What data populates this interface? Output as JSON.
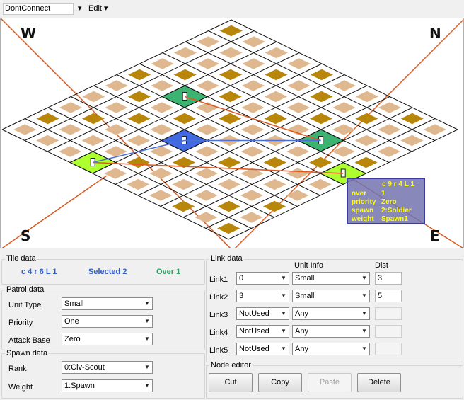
{
  "toolbar": {
    "map_name": "DontConnect",
    "menu_arrow": "▾",
    "edit_label": "Edit ▾"
  },
  "compass": {
    "w": "W",
    "n": "N",
    "s": "S",
    "e": "E"
  },
  "tooltip": {
    "header": "c 9  r 4  L 1",
    "rows": [
      {
        "key": "over",
        "value": "1"
      },
      {
        "key": "priority",
        "value": "Zero"
      },
      {
        "key": "spawn",
        "value": "2:Soldier"
      },
      {
        "key": "weight",
        "value": "Spawn1"
      }
    ]
  },
  "tile_data": {
    "title": "Tile data",
    "coords": "c 4  r 6  L 1",
    "selected": "Selected 2",
    "over": "Over 1",
    "colors": {
      "coords": "#3060c8",
      "selected": "#3060c8",
      "over": "#30a060"
    }
  },
  "patrol_data": {
    "title": "Patrol data",
    "unit_type": {
      "label": "Unit Type",
      "value": "Small"
    },
    "priority": {
      "label": "Priority",
      "value": "One"
    },
    "attack_base": {
      "label": "Attack Base",
      "value": "Zero"
    }
  },
  "spawn_data": {
    "title": "Spawn data",
    "rank": {
      "label": "Rank",
      "value": "0:Civ-Scout"
    },
    "weight": {
      "label": "Weight",
      "value": "1:Spawn"
    }
  },
  "link_data": {
    "title": "Link data",
    "col_unit_info": "Unit Info",
    "col_dist": "Dist",
    "links": [
      {
        "label": "Link1",
        "target": "0",
        "unit": "Small",
        "dist": "3"
      },
      {
        "label": "Link2",
        "target": "3",
        "unit": "Small",
        "dist": "5"
      },
      {
        "label": "Link3",
        "target": "NotUsed",
        "unit": "Any",
        "dist": ""
      },
      {
        "label": "Link4",
        "target": "NotUsed",
        "unit": "Any",
        "dist": ""
      },
      {
        "label": "Link5",
        "target": "NotUsed",
        "unit": "Any",
        "dist": ""
      }
    ]
  },
  "node_editor": {
    "title": "Node editor",
    "cut": "Cut",
    "copy": "Copy",
    "paste": "Paste",
    "delete": "Delete"
  },
  "map_colors": {
    "grid": "#111111",
    "tile_dark": "#b8860b",
    "tile_light": "#e0b890",
    "node_green": "#3cb371",
    "node_lime": "#adff2f",
    "node_blue": "#4169e1",
    "link_orange": "#e05a20",
    "link_blue": "#4a6fd8",
    "view_lines": "#d85a20"
  }
}
